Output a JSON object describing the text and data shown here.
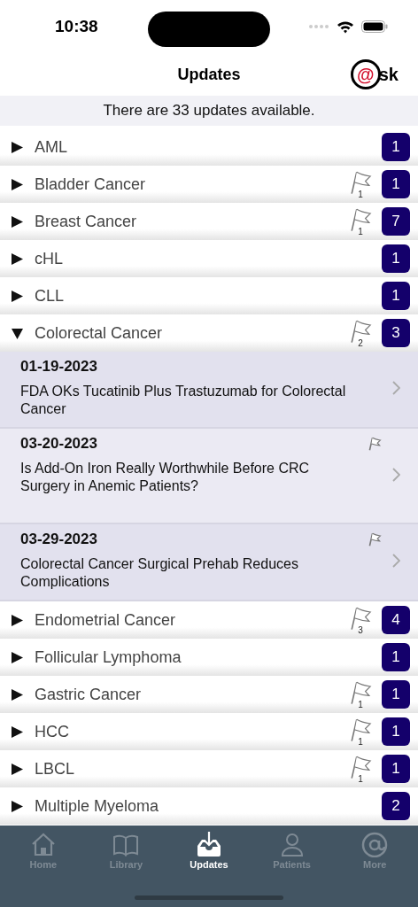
{
  "status_bar": {
    "time": "10:38"
  },
  "nav": {
    "title": "Updates",
    "logo": {
      "mark": "@",
      "text": "sk"
    }
  },
  "summary": "There are 33 updates available.",
  "categories": [
    {
      "name": "AML",
      "expanded": false,
      "count": "1"
    },
    {
      "name": "Bladder Cancer",
      "expanded": false,
      "count": "1",
      "flags": "1"
    },
    {
      "name": "Breast Cancer",
      "expanded": false,
      "count": "7",
      "flags": "1"
    },
    {
      "name": "cHL",
      "expanded": false,
      "count": "1"
    },
    {
      "name": "CLL",
      "expanded": false,
      "count": "1"
    },
    {
      "name": "Colorectal Cancer",
      "expanded": true,
      "count": "3",
      "flags": "2",
      "articles": [
        {
          "date": "01-19-2023",
          "title": "FDA OKs Tucatinib Plus Trastuzumab for Colorectal Cancer",
          "flagged": false
        },
        {
          "date": "03-20-2023",
          "title": "Is Add-On Iron Really Worthwhile Before CRC Surgery in Anemic Patients?",
          "flagged": true
        },
        {
          "date": "03-29-2023",
          "title": "Colorectal Cancer Surgical Prehab Reduces Complications",
          "flagged": true
        }
      ]
    },
    {
      "name": "Endometrial Cancer",
      "expanded": false,
      "count": "4",
      "flags": "3"
    },
    {
      "name": "Follicular Lymphoma",
      "expanded": false,
      "count": "1"
    },
    {
      "name": "Gastric Cancer",
      "expanded": false,
      "count": "1",
      "flags": "1"
    },
    {
      "name": "HCC",
      "expanded": false,
      "count": "1",
      "flags": "1"
    },
    {
      "name": "LBCL",
      "expanded": false,
      "count": "1",
      "flags": "1"
    },
    {
      "name": "Multiple Myeloma",
      "expanded": false,
      "count": "2"
    }
  ],
  "tabs": [
    {
      "label": "Home",
      "kind": "home",
      "selected": false
    },
    {
      "label": "Library",
      "kind": "library",
      "selected": false
    },
    {
      "label": "Updates",
      "kind": "updates",
      "selected": true
    },
    {
      "label": "Patients",
      "kind": "patients",
      "selected": false
    },
    {
      "label": "More",
      "kind": "more",
      "selected": false
    }
  ]
}
